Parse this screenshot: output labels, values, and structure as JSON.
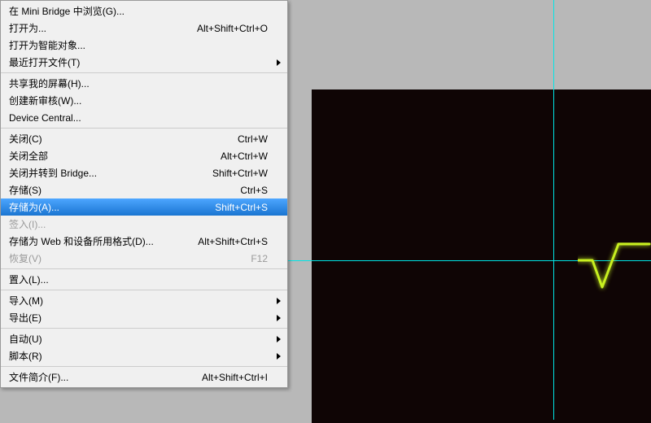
{
  "menu": {
    "groups": [
      [
        {
          "label": "在 Mini Bridge 中浏览(G)...",
          "shortcut": "",
          "submenu": false,
          "disabled": false,
          "highlighted": false
        },
        {
          "label": "打开为...",
          "shortcut": "Alt+Shift+Ctrl+O",
          "submenu": false,
          "disabled": false,
          "highlighted": false
        },
        {
          "label": "打开为智能对象...",
          "shortcut": "",
          "submenu": false,
          "disabled": false,
          "highlighted": false
        },
        {
          "label": "最近打开文件(T)",
          "shortcut": "",
          "submenu": true,
          "disabled": false,
          "highlighted": false
        }
      ],
      [
        {
          "label": "共享我的屏幕(H)...",
          "shortcut": "",
          "submenu": false,
          "disabled": false,
          "highlighted": false
        },
        {
          "label": "创建新审核(W)...",
          "shortcut": "",
          "submenu": false,
          "disabled": false,
          "highlighted": false
        },
        {
          "label": "Device Central...",
          "shortcut": "",
          "submenu": false,
          "disabled": false,
          "highlighted": false
        }
      ],
      [
        {
          "label": "关闭(C)",
          "shortcut": "Ctrl+W",
          "submenu": false,
          "disabled": false,
          "highlighted": false
        },
        {
          "label": "关闭全部",
          "shortcut": "Alt+Ctrl+W",
          "submenu": false,
          "disabled": false,
          "highlighted": false
        },
        {
          "label": "关闭并转到 Bridge...",
          "shortcut": "Shift+Ctrl+W",
          "submenu": false,
          "disabled": false,
          "highlighted": false
        },
        {
          "label": "存储(S)",
          "shortcut": "Ctrl+S",
          "submenu": false,
          "disabled": false,
          "highlighted": false
        },
        {
          "label": "存储为(A)...",
          "shortcut": "Shift+Ctrl+S",
          "submenu": false,
          "disabled": false,
          "highlighted": true
        },
        {
          "label": "签入(I)...",
          "shortcut": "",
          "submenu": false,
          "disabled": true,
          "highlighted": false
        },
        {
          "label": "存储为 Web 和设备所用格式(D)...",
          "shortcut": "Alt+Shift+Ctrl+S",
          "submenu": false,
          "disabled": false,
          "highlighted": false
        },
        {
          "label": "恢复(V)",
          "shortcut": "F12",
          "submenu": false,
          "disabled": true,
          "highlighted": false
        }
      ],
      [
        {
          "label": "置入(L)...",
          "shortcut": "",
          "submenu": false,
          "disabled": false,
          "highlighted": false
        }
      ],
      [
        {
          "label": "导入(M)",
          "shortcut": "",
          "submenu": true,
          "disabled": false,
          "highlighted": false
        },
        {
          "label": "导出(E)",
          "shortcut": "",
          "submenu": true,
          "disabled": false,
          "highlighted": false
        }
      ],
      [
        {
          "label": "自动(U)",
          "shortcut": "",
          "submenu": true,
          "disabled": false,
          "highlighted": false
        },
        {
          "label": "脚本(R)",
          "shortcut": "",
          "submenu": true,
          "disabled": false,
          "highlighted": false
        }
      ],
      [
        {
          "label": "文件简介(F)...",
          "shortcut": "Alt+Shift+Ctrl+I",
          "submenu": false,
          "disabled": false,
          "highlighted": false
        }
      ]
    ]
  },
  "colors": {
    "highlight": "#3399ff",
    "guide": "#00e6e6",
    "canvas": "#0f0505",
    "wave": "#c8f020"
  }
}
